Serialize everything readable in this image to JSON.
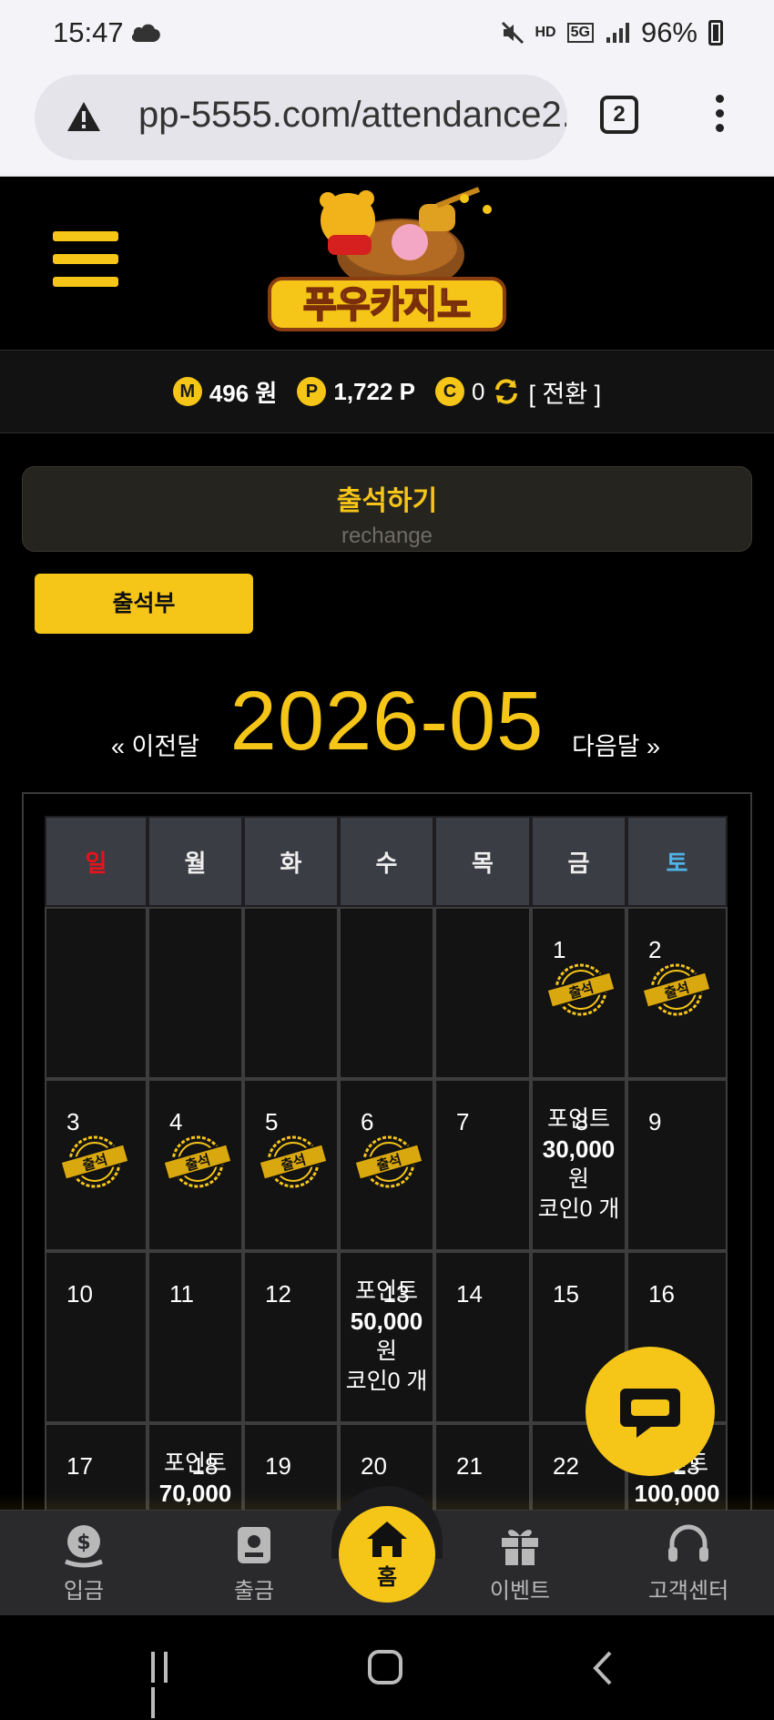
{
  "status_bar": {
    "time": "15:47",
    "network": "5G",
    "hd_label": "HD",
    "battery": "96%"
  },
  "browser": {
    "url": "pp-5555.com/attendance2.asp",
    "tab_count": "2"
  },
  "site": {
    "logo_text": "푸우카지노"
  },
  "balance": {
    "money_badge": "M",
    "money": "496 원",
    "point_badge": "P",
    "points": "1,722 P",
    "coin_badge": "C",
    "coins": "0",
    "convert_label": "[ 전환 ]"
  },
  "attendance": {
    "title": "출석하기",
    "subtitle": "rechange",
    "book_button": "출석부",
    "prev_label": "« 이전달",
    "month": "2026-05",
    "next_label": "다음달 »",
    "stamp_text": "출석"
  },
  "calendar": {
    "weekdays": [
      "일",
      "월",
      "화",
      "수",
      "목",
      "금",
      "토"
    ],
    "weeks": [
      [
        {
          "day": ""
        },
        {
          "day": ""
        },
        {
          "day": ""
        },
        {
          "day": ""
        },
        {
          "day": ""
        },
        {
          "day": "1",
          "stamp": true
        },
        {
          "day": "2",
          "stamp": true
        }
      ],
      [
        {
          "day": "3",
          "stamp": true
        },
        {
          "day": "4",
          "stamp": true
        },
        {
          "day": "5",
          "stamp": true
        },
        {
          "day": "6",
          "stamp": true
        },
        {
          "day": "7"
        },
        {
          "day": "8",
          "reward": {
            "label": "포인트",
            "amount": "30,000",
            "unit": "원",
            "coin": "코인0 개"
          }
        },
        {
          "day": "9"
        }
      ],
      [
        {
          "day": "10"
        },
        {
          "day": "11"
        },
        {
          "day": "12"
        },
        {
          "day": "13",
          "reward": {
            "label": "포인트",
            "amount": "50,000",
            "unit": "원",
            "coin": "코인0 개"
          }
        },
        {
          "day": "14"
        },
        {
          "day": "15"
        },
        {
          "day": "16"
        }
      ],
      [
        {
          "day": "17"
        },
        {
          "day": "18",
          "reward": {
            "label": "포인트",
            "amount": "70,000",
            "unit": "",
            "coin": ""
          }
        },
        {
          "day": "19"
        },
        {
          "day": "20"
        },
        {
          "day": "21"
        },
        {
          "day": "22"
        },
        {
          "day": "23",
          "reward": {
            "label": "포인트",
            "amount": "100,000",
            "unit": "",
            "coin": ""
          }
        }
      ]
    ]
  },
  "bottom_nav": {
    "deposit": "입금",
    "withdraw": "출금",
    "home": "홈",
    "event": "이벤트",
    "support": "고객센터"
  },
  "colors": {
    "accent": "#f5c518",
    "sunday": "#e8121b",
    "saturday": "#4fb3e8"
  }
}
